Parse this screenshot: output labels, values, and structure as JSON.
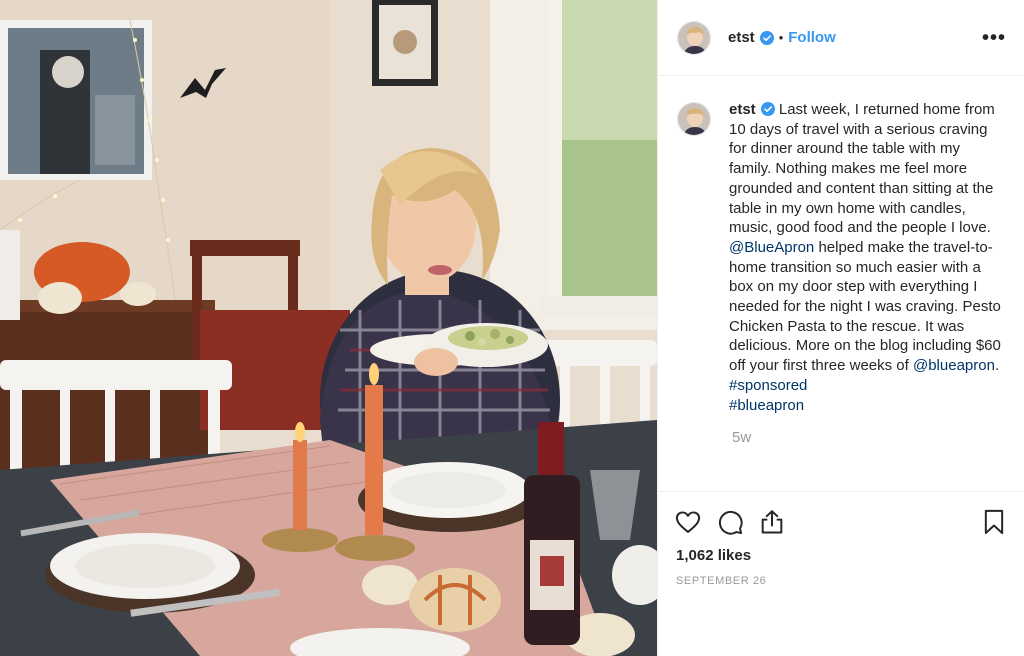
{
  "header": {
    "username": "etst",
    "separator": "•",
    "follow_label": "Follow",
    "more_label": "•••"
  },
  "caption": {
    "username": "etst",
    "text_1": "Last week, I returned home from 10 days of travel with a serious craving for dinner around the table with my family. Nothing makes me feel more grounded and content than sitting at the table in my own home with candles, music, good food and the people I love. ",
    "mention_1": "@BlueApron",
    "text_2": " helped make the travel-to-home transition so much easier with a box on my door step with everything I needed for the night I was craving. Pesto Chicken Pasta to the rescue. It was delicious. More on the blog including $60 off your first three weeks of ",
    "mention_2": "@blueapron",
    "text_3": ". ",
    "hashtag_1": "#sponsored",
    "hashtag_2": "#blueapron",
    "age": "5w"
  },
  "actions": {
    "like_icon": "heart-icon",
    "comment_icon": "comment-icon",
    "share_icon": "share-icon",
    "save_icon": "bookmark-icon"
  },
  "likes": "1,062 likes",
  "date": "SEPTEMBER 26",
  "colors": {
    "link_blue": "#3897f0",
    "mention_blue": "#003569",
    "muted": "#999999",
    "text": "#262626"
  }
}
